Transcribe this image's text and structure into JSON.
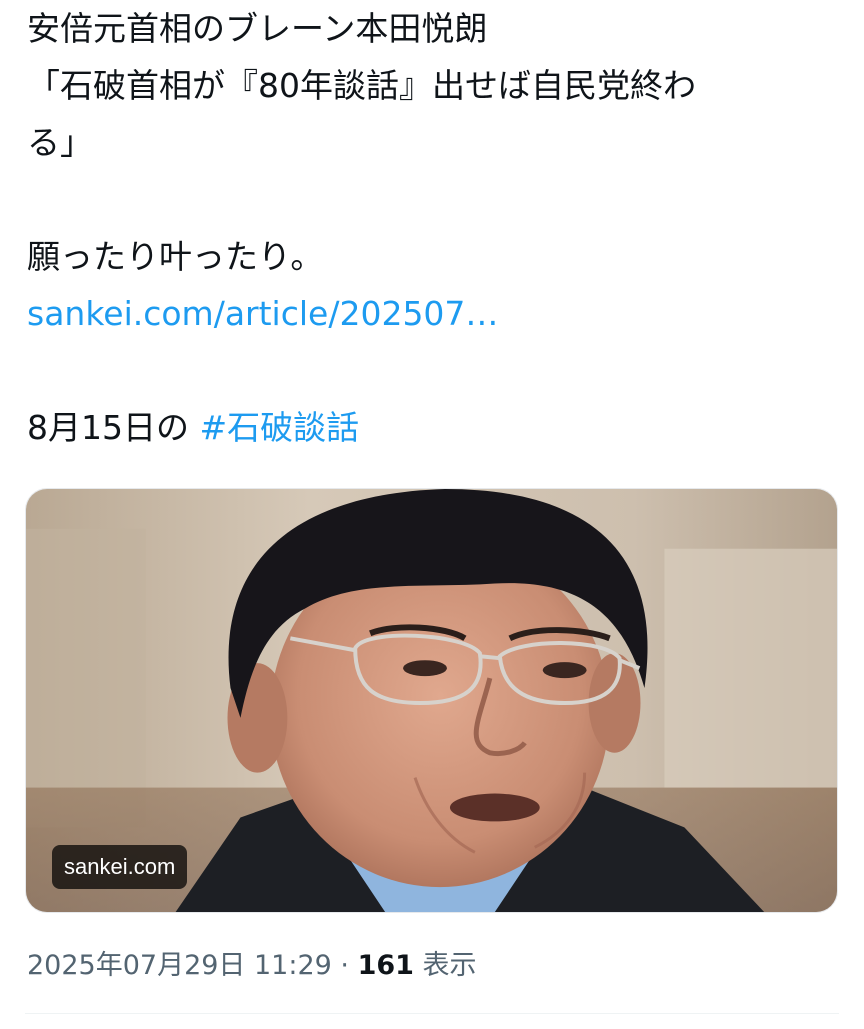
{
  "tweet": {
    "lines": [
      "安倍元首相のブレーン本田悦朗",
      "「石破首相が『80年談話』出せば自民党終わ",
      "る」",
      "願ったり叶ったり。"
    ],
    "link_text": "sankei.com/article/202507…",
    "hashtag_prefix": "8月15日の ",
    "hashtag": "#石破談話"
  },
  "card": {
    "domain": "sankei.com"
  },
  "meta": {
    "timestamp": "2025年07月29日 11:29",
    "separator": " · ",
    "views_count": "161",
    "views_label": " 表示"
  },
  "colors": {
    "link": "#1d9bf0",
    "text": "#0f1419",
    "secondary": "#536471"
  }
}
